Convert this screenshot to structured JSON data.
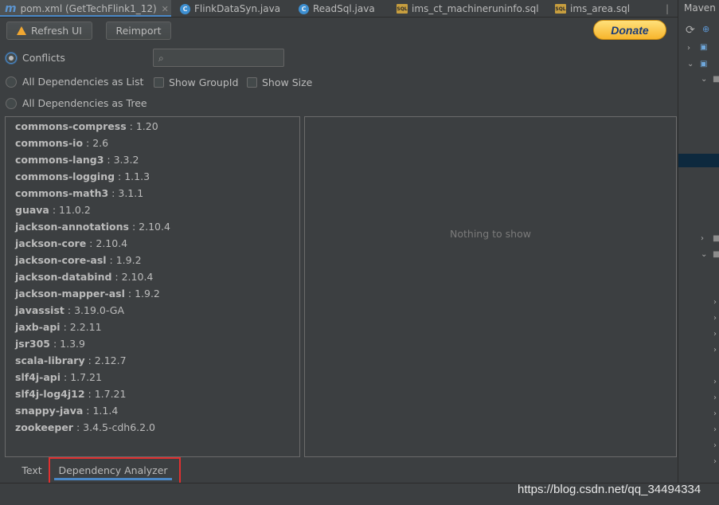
{
  "editor_tabs": [
    {
      "label": "pom.xml (GetTechFlink1_12)",
      "icon": "maven-icon",
      "active": true,
      "closable": true
    },
    {
      "label": "FlinkDataSyn.java",
      "icon": "class-icon",
      "active": false,
      "closable": false
    },
    {
      "label": "ReadSql.java",
      "icon": "class-icon",
      "active": false,
      "closable": false
    },
    {
      "label": "ims_ct_machineruninfo.sql",
      "icon": "sql-icon",
      "active": false,
      "closable": false
    },
    {
      "label": "ims_area.sql",
      "icon": "sql-icon",
      "active": false,
      "closable": false
    }
  ],
  "right_panel": {
    "title": "Maven"
  },
  "toolbar": {
    "refresh_label": "Refresh UI",
    "reimport_label": "Reimport",
    "donate_label": "Donate"
  },
  "view_modes": {
    "conflicts": "Conflicts",
    "list": "All Dependencies as List",
    "tree": "All Dependencies as Tree",
    "selected": "conflicts"
  },
  "options": {
    "show_groupid": "Show GroupId",
    "show_size": "Show Size"
  },
  "search": {
    "value": ""
  },
  "dependencies": [
    {
      "name": "commons-compress",
      "version": "1.20"
    },
    {
      "name": "commons-io",
      "version": "2.6"
    },
    {
      "name": "commons-lang3",
      "version": "3.3.2"
    },
    {
      "name": "commons-logging",
      "version": "1.1.3"
    },
    {
      "name": "commons-math3",
      "version": "3.1.1"
    },
    {
      "name": "guava",
      "version": "11.0.2"
    },
    {
      "name": "jackson-annotations",
      "version": "2.10.4"
    },
    {
      "name": "jackson-core",
      "version": "2.10.4"
    },
    {
      "name": "jackson-core-asl",
      "version": "1.9.2"
    },
    {
      "name": "jackson-databind",
      "version": "2.10.4"
    },
    {
      "name": "jackson-mapper-asl",
      "version": "1.9.2"
    },
    {
      "name": "javassist",
      "version": "3.19.0-GA"
    },
    {
      "name": "jaxb-api",
      "version": "2.2.11"
    },
    {
      "name": "jsr305",
      "version": "1.3.9"
    },
    {
      "name": "scala-library",
      "version": "2.12.7"
    },
    {
      "name": "slf4j-api",
      "version": "1.7.21"
    },
    {
      "name": "slf4j-log4j12",
      "version": "1.7.21"
    },
    {
      "name": "snappy-java",
      "version": "1.1.4"
    },
    {
      "name": "zookeeper",
      "version": "3.4.5-cdh6.2.0"
    }
  ],
  "detail": {
    "empty_text": "Nothing to show"
  },
  "bottom_tabs": {
    "text": "Text",
    "analyzer": "Dependency Analyzer",
    "active": "analyzer"
  },
  "watermark": "https://blog.csdn.net/qq_34494334",
  "colors": {
    "accent": "#4a88c7",
    "highlight": "#e03030",
    "background": "#3c3f41"
  }
}
